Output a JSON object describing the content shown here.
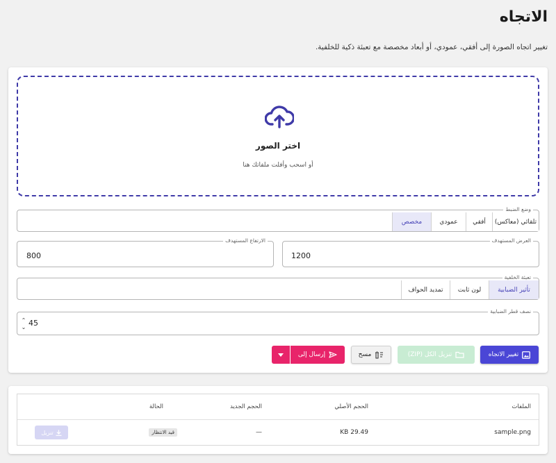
{
  "header": {
    "title": "الاتجاه",
    "description": "تغيير اتجاه الصورة إلى أفقي، عمودي، أو أبعاد مخصصة مع تعبئة ذكية للخلفية."
  },
  "dropzone": {
    "title": "اختر الصور",
    "subtitle": "أو اسحب وأفلت ملفاتك هنا",
    "icon": "cloud-upload-icon"
  },
  "orientation": {
    "legend": "وضع الضبط",
    "options": [
      "تلقائي (معاكس)",
      "أفقي",
      "عمودي",
      "مخصص"
    ],
    "selected": "مخصص"
  },
  "dimensions": {
    "width_label": "العرض المستهدف",
    "width_value": "1200",
    "height_label": "الارتفاع المستهدف",
    "height_value": "800"
  },
  "background": {
    "legend": "تعبئة الخلفية",
    "options": [
      "تأثير الضبابية",
      "لون ثابت",
      "تمديد الحواف"
    ],
    "selected": "تأثير الضبابية"
  },
  "blur": {
    "label": "نصف قطر الضبابية",
    "value": "45"
  },
  "actions": {
    "orient_label": "تغيير الاتجاه",
    "zip_label": "تنزيل الكل (ZIP)",
    "clear_label": "مسح",
    "send_label": "إرسال إلى"
  },
  "files_table": {
    "headers": [
      "الملفات",
      "الحجم الأصلي",
      "الحجم الجديد",
      "الحالة"
    ],
    "rows": [
      {
        "name": "sample.png",
        "original": "29.49 KB",
        "new": "—",
        "status": "قيد الانتظار",
        "download": "تنزيل"
      }
    ]
  },
  "colors": {
    "primary": "#4a46d6",
    "accent_pink": "#e8246a",
    "zip_disabled": "#c8ecd3",
    "dropzone_border": "#3f3aa8"
  }
}
